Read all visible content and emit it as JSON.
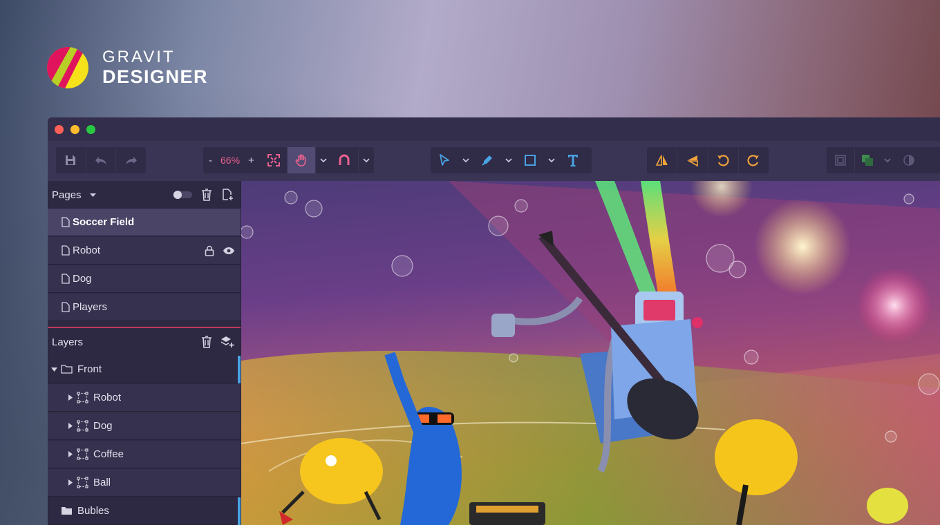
{
  "brand": {
    "line1": "GRAVIT",
    "line2": "DESIGNER"
  },
  "window": {
    "traffic_lights": [
      "#fe5f57",
      "#febc2e",
      "#28c840"
    ]
  },
  "toolbar": {
    "zoom": {
      "minus": "-",
      "value": "66%",
      "plus": "+"
    },
    "icons": [
      "save-icon",
      "undo-icon",
      "redo-icon",
      "fit-screen-icon",
      "hand-icon",
      "magnet-icon",
      "pointer-icon",
      "pen-icon",
      "rectangle-icon",
      "text-icon",
      "flip-horizontal-icon",
      "flip-vertical-icon",
      "rotate-left-icon",
      "rotate-right-icon",
      "group-icon",
      "boolean-icon",
      "mask-icon"
    ],
    "accent": "#e9628e",
    "active_tool": "hand-icon"
  },
  "pages": {
    "title": "Pages",
    "items": [
      {
        "label": "Soccer Field",
        "selected": true
      },
      {
        "label": "Robot",
        "locked": true,
        "visible": true
      },
      {
        "label": "Dog"
      },
      {
        "label": "Players"
      }
    ]
  },
  "layers": {
    "title": "Layers",
    "items": [
      {
        "label": "Front",
        "type": "folder",
        "expanded": true
      },
      {
        "label": "Robot",
        "type": "group"
      },
      {
        "label": "Dog",
        "type": "group"
      },
      {
        "label": "Coffee",
        "type": "group"
      },
      {
        "label": "Ball",
        "type": "group"
      },
      {
        "label": "Bubles",
        "type": "folder"
      }
    ]
  },
  "colors": {
    "selection_accent": "#48a3e3",
    "panel_divider": "#c0395a"
  }
}
